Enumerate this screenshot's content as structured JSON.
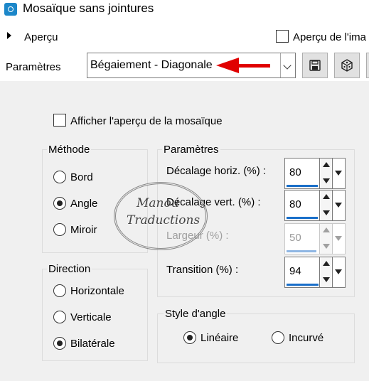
{
  "window": {
    "title": "Mosaïque sans jointures"
  },
  "preview_row": {
    "expander_label": "Aperçu",
    "preview_in_image_label": "Aperçu de l'ima"
  },
  "presets": {
    "label": "Paramètres",
    "selected": "Bégaiement - Diagonale"
  },
  "show_tile_preview_label": "Afficher l'aperçu de la mosaïque",
  "method": {
    "title": "Méthode",
    "options": [
      "Bord",
      "Angle",
      "Miroir"
    ],
    "selected": "Angle"
  },
  "direction": {
    "title": "Direction",
    "options": [
      "Horizontale",
      "Verticale",
      "Bilatérale"
    ],
    "selected": "Bilatérale"
  },
  "parameters": {
    "title": "Paramètres",
    "horiz_offset": {
      "label": "Décalage horiz. (%) :",
      "value": "80"
    },
    "vert_offset": {
      "label": "Décalage vert. (%) :",
      "value": "80"
    },
    "width": {
      "label": "Largeur (%) :",
      "value": "50",
      "enabled": false
    },
    "transition": {
      "label": "Transition (%) :",
      "value": "94"
    }
  },
  "corner_style": {
    "title": "Style d'angle",
    "options": [
      "Linéaire",
      "Incurvé"
    ],
    "selected": "Linéaire"
  },
  "watermark": {
    "line1": "Manou",
    "line2": "Traductions"
  },
  "colors": {
    "accent": "#1a6fc9",
    "annotation_arrow": "#e00000",
    "panel_bg": "#f0f0f0"
  }
}
